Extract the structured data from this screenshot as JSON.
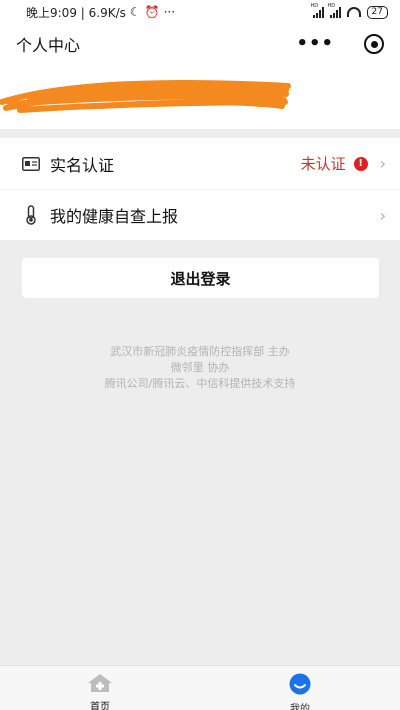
{
  "status_bar": {
    "time_speed": "晚上9:09 | 6.9K/s",
    "more": "···",
    "signal1_label": "HD",
    "signal2_label": "HD",
    "battery": "27"
  },
  "header": {
    "title": "个人中心",
    "more_dots": "•••"
  },
  "menu": {
    "real_name": {
      "label": "实名认证",
      "status": "未认证",
      "alert": "!"
    },
    "health": {
      "label": "我的健康自查上报"
    },
    "chevron": "›"
  },
  "logout_label": "退出登录",
  "footer": {
    "line1": "武汉市新冠肺炎疫情防控指挥部 主办",
    "line2": "微邻里 协办",
    "line3": "腾讯公司/腾讯云、中信科提供技术支持"
  },
  "tabbar": {
    "home": "首页",
    "mine": "我的"
  },
  "colors": {
    "status_red": "#c0392b",
    "alert_red": "#e02020",
    "tab_active_blue": "#1a73e8",
    "tab_inactive_gray": "#bdbdbd",
    "scribble_orange": "#f4891f"
  }
}
